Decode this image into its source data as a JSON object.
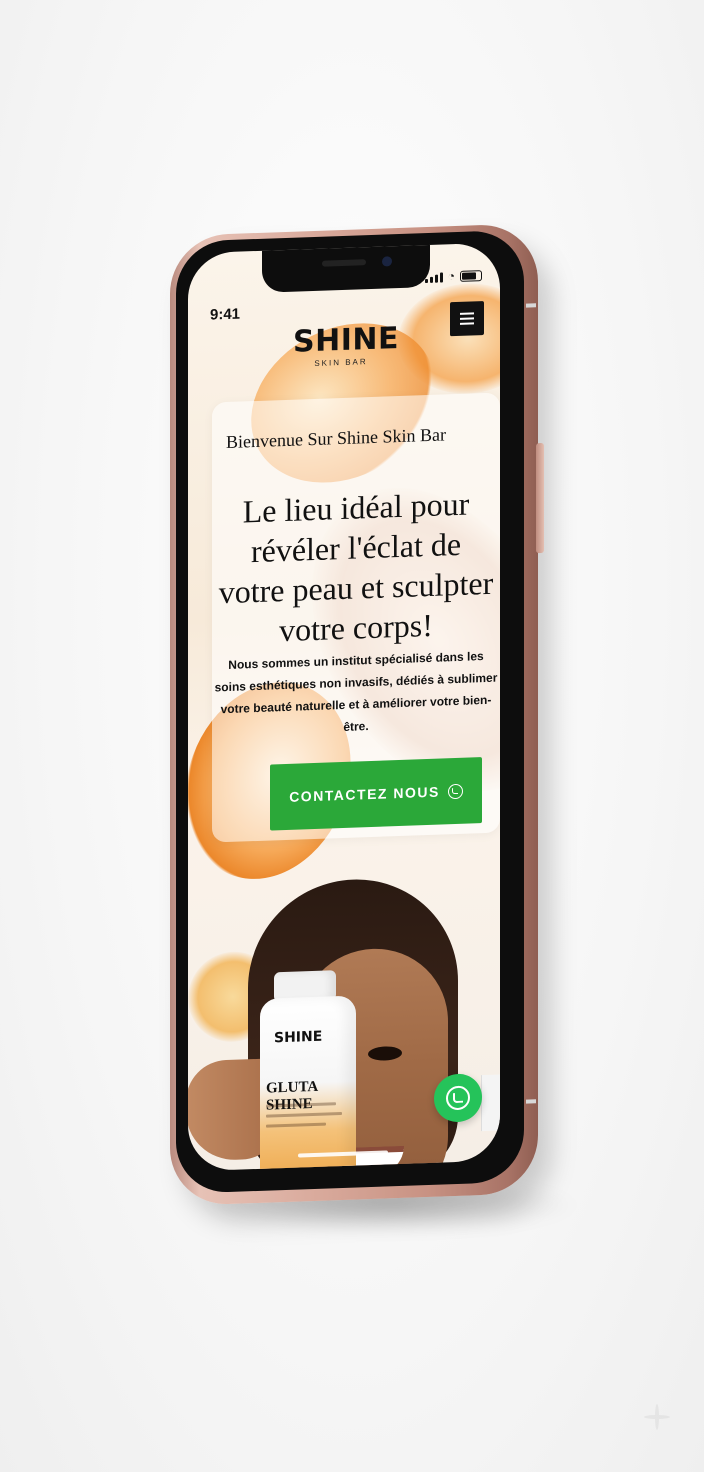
{
  "status_bar": {
    "time": "9:41"
  },
  "header": {
    "logo_main": "SHINE",
    "logo_sub": "SKIN BAR",
    "menu_icon": "hamburger-icon"
  },
  "hero": {
    "welcome": "Bienvenue Sur Shine Skin Bar",
    "headline": "Le lieu idéal pour révéler l'éclat de votre peau et sculpter votre corps!",
    "description": "Nous sommes un institut spécialisé dans les soins esthétiques non invasifs, dédiés à sublimer votre beauté naturelle et à améliorer votre bien-être.",
    "cta_label": "CONTACTEZ NOUS",
    "cta_icon": "whatsapp-icon",
    "cta_color": "#2ba839"
  },
  "product": {
    "brand": "SHINE",
    "name": "GLUTA SHINE"
  },
  "floating": {
    "whatsapp_icon": "whatsapp-icon",
    "color": "#25c35a"
  }
}
